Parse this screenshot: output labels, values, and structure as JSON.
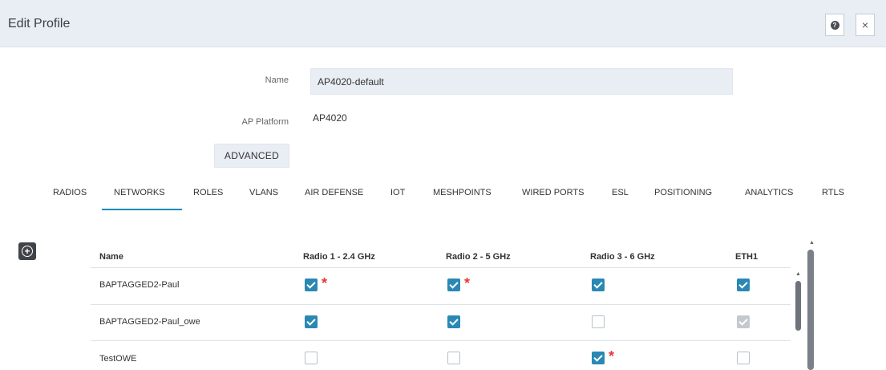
{
  "header": {
    "title": "Edit Profile",
    "help_icon": "question-circle-icon",
    "close_icon": "close-icon",
    "close_glyph": "×",
    "help_glyph": "?"
  },
  "form": {
    "name_label": "Name",
    "name_value": "AP4020-default",
    "platform_label": "AP Platform",
    "platform_value": "AP4020",
    "advanced_label": "ADVANCED"
  },
  "tabs": [
    {
      "label": "RADIOS",
      "active": false
    },
    {
      "label": "NETWORKS",
      "active": true
    },
    {
      "label": "ROLES",
      "active": false
    },
    {
      "label": "VLANS",
      "active": false
    },
    {
      "label": "AIR DEFENSE",
      "active": false
    },
    {
      "label": "IOT",
      "active": false
    },
    {
      "label": "MESHPOINTS",
      "active": false
    },
    {
      "label": "WIRED PORTS",
      "active": false
    },
    {
      "label": "ESL",
      "active": false
    },
    {
      "label": "POSITIONING",
      "active": false
    },
    {
      "label": "ANALYTICS",
      "active": false
    },
    {
      "label": "RTLS",
      "active": false
    }
  ],
  "table": {
    "add_icon": "plus-circle-icon",
    "add_glyph": "+",
    "columns": [
      "Name",
      "Radio 1 - 2.4 GHz",
      "Radio 2 - 5 GHz",
      "Radio 3 - 6 GHz",
      "ETH1"
    ],
    "rows": [
      {
        "name": "BAPTAGGED2-Paul",
        "r1": "checked-required",
        "r2": "checked-required",
        "r3": "checked",
        "eth1": "checked"
      },
      {
        "name": "BAPTAGGED2-Paul_owe",
        "r1": "checked",
        "r2": "checked",
        "r3": "unchecked",
        "eth1": "checked-disabled"
      },
      {
        "name": "TestOWE",
        "r1": "unchecked",
        "r2": "unchecked",
        "r3": "checked-required",
        "eth1": "unchecked"
      }
    ],
    "required_marker": "*"
  },
  "colors": {
    "accent": "#2a88b4",
    "tab_underline": "#1b8bb7",
    "required": "#e53935",
    "header_bg": "#e9edf4"
  }
}
